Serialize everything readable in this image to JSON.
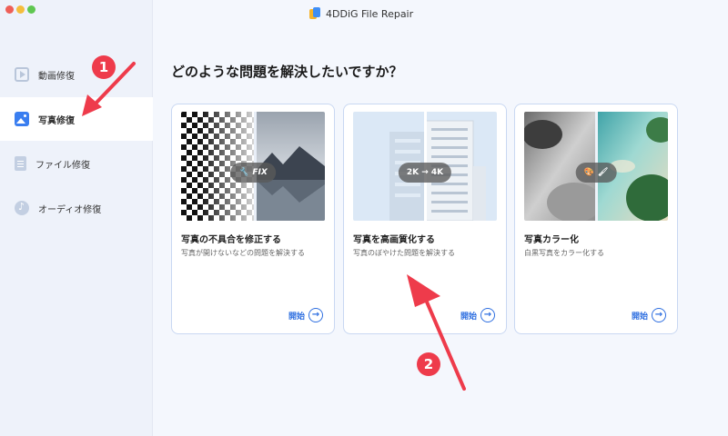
{
  "window": {
    "title": "4DDiG File Repair"
  },
  "sidebar": {
    "items": [
      {
        "label": "動画修復",
        "icon": "video-icon",
        "active": false
      },
      {
        "label": "写真修復",
        "icon": "photo-icon",
        "active": true
      },
      {
        "label": "ファイル修復",
        "icon": "file-icon",
        "active": false
      },
      {
        "label": "オーディオ修復",
        "icon": "audio-icon",
        "active": false
      }
    ]
  },
  "main": {
    "heading": "どのような問題を解決したいですか？",
    "cards": [
      {
        "title": "写真の不具合を修正する",
        "description": "写真が開けないなどの問題を解決する",
        "badge": "FIX",
        "badge_icon": "wrench-icon",
        "start_label": "開始"
      },
      {
        "title": "写真を高画質化する",
        "description": "写真のぼやけた問題を解決する",
        "badge": "2K → 4K",
        "badge_icon": "",
        "start_label": "開始"
      },
      {
        "title": "写真カラー化",
        "description": "白黒写真をカラー化する",
        "badge": "",
        "badge_icon": "palette-icon",
        "start_label": "開始"
      }
    ]
  },
  "annotations": {
    "step1": "1",
    "step2": "2"
  },
  "colors": {
    "accent": "#2f6fe0",
    "annotation": "#ee3b4b",
    "card_border": "#c9d8f2"
  }
}
